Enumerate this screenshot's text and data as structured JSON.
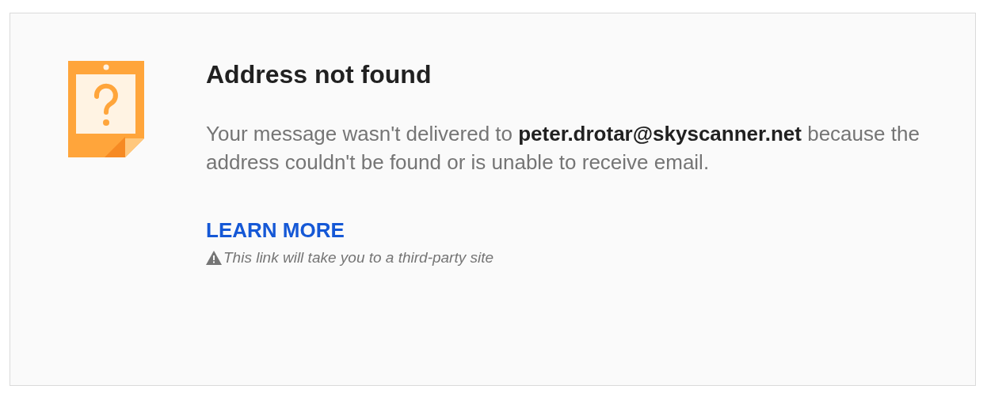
{
  "title": "Address not found",
  "message": "Your message wasn't delivered to **peter.drotar@skyscanner.net** because the address couldn't be found or is unable to receive email.",
  "link": {
    "label": "LEARN MORE"
  },
  "warning": "This link will take you to a third-party site"
}
